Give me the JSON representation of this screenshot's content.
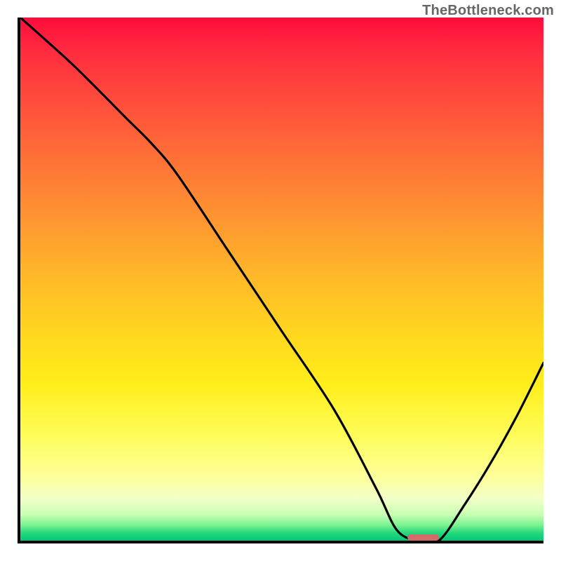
{
  "watermark": "TheBottleneck.com",
  "chart_data": {
    "type": "line",
    "title": "",
    "xlabel": "",
    "ylabel": "",
    "xlim": [
      0,
      100
    ],
    "ylim": [
      0,
      100
    ],
    "series": [
      {
        "name": "curve",
        "x": [
          0,
          10,
          20,
          25,
          30,
          40,
          50,
          60,
          68,
          72,
          76,
          80,
          85,
          90,
          95,
          100
        ],
        "y": [
          100,
          91,
          81,
          76,
          70,
          55,
          40,
          25,
          10,
          2,
          0,
          0,
          7,
          15,
          24,
          34
        ]
      }
    ],
    "marker": {
      "x": 77,
      "y": 0,
      "width": 6,
      "height": 1.2,
      "color": "#d46a6a"
    },
    "gradient_stops": [
      {
        "pos": 0.0,
        "color": "#ff0b3b"
      },
      {
        "pos": 0.2,
        "color": "#ff5a3a"
      },
      {
        "pos": 0.48,
        "color": "#ffb32a"
      },
      {
        "pos": 0.7,
        "color": "#ffee1a"
      },
      {
        "pos": 0.88,
        "color": "#fdff9c"
      },
      {
        "pos": 0.97,
        "color": "#7cf291"
      },
      {
        "pos": 1.0,
        "color": "#00c878"
      }
    ]
  }
}
